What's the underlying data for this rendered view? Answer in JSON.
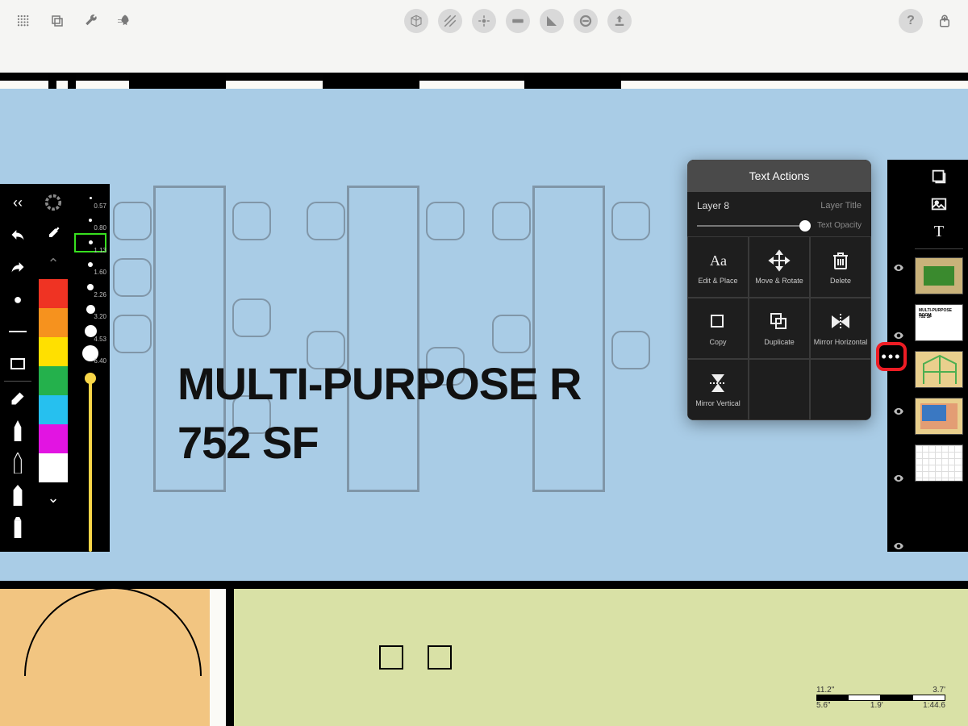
{
  "top_toolbar": {
    "left": [
      "grid-icon",
      "layers-icon",
      "wrench-icon",
      "rocket-icon"
    ],
    "center": [
      "cube-icon",
      "hatch-icon",
      "anchor-icon",
      "ruler-icon",
      "angle-icon",
      "minus-icon",
      "upload-icon"
    ],
    "right": [
      "help-icon",
      "share-icon"
    ]
  },
  "room": {
    "title": "MULTI-PURPOSE ROOM",
    "title_visible": "MULTI-PURPOSE R",
    "area": "752 SF"
  },
  "left_tools": {
    "swatches": [
      "#ef3323",
      "#f6921e",
      "#ffe000",
      "#24b14c",
      "#26c0ef",
      "#e214e2",
      "#ffffff"
    ],
    "brushes": [
      {
        "size": 3,
        "label": "0.57"
      },
      {
        "size": 4,
        "label": "0.80"
      },
      {
        "size": 5,
        "label": "1.13",
        "selected": true
      },
      {
        "size": 6,
        "label": "1.60"
      },
      {
        "size": 8,
        "label": "2.26"
      },
      {
        "size": 11,
        "label": "3.20"
      },
      {
        "size": 15,
        "label": "4.53"
      },
      {
        "size": 20,
        "label": "6.40"
      }
    ]
  },
  "text_actions": {
    "title": "Text Actions",
    "layer_name": "Layer 8",
    "layer_label": "Layer Title",
    "opacity_label": "Text Opacity",
    "actions": [
      {
        "id": "edit-place",
        "label": "Edit & Place"
      },
      {
        "id": "move-rotate",
        "label": "Move & Rotate"
      },
      {
        "id": "delete",
        "label": "Delete"
      },
      {
        "id": "copy",
        "label": "Copy"
      },
      {
        "id": "duplicate",
        "label": "Duplicate"
      },
      {
        "id": "mirror-h",
        "label": "Mirror Horizontal"
      },
      {
        "id": "mirror-v",
        "label": "Mirror Vertical"
      }
    ]
  },
  "right_strip": {
    "tools": [
      "shape-tool-icon",
      "image-tool-icon",
      "text-tool-icon"
    ],
    "thumb_active_text1": "MULTI-PURPOSE ROOM",
    "thumb_active_text2": "752 SF"
  },
  "scale": {
    "top_left": "11.2\"",
    "top_right": "3.7'",
    "bot_left": "5.6\"",
    "bot_mid": "1.9'",
    "bot_right": "1:44.6"
  }
}
